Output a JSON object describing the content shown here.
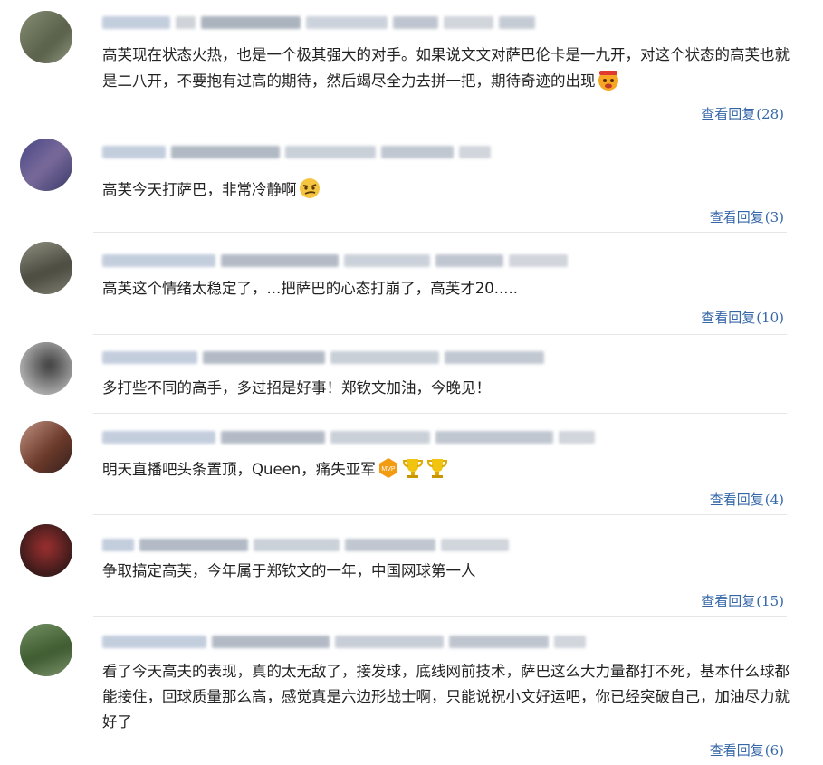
{
  "comments": [
    {
      "text": "高芙现在状态火热，也是一个极其强大的对手。如果说文文对萨巴伦卡是一九开，对这个状态的高芙也就是二八开，不要抱有过高的期待，然后竭尽全力去拼一把，期待奇迹的出现",
      "reply_label": "查看回复",
      "reply_count": "(28)",
      "emojis": [
        "angry-face-emoji"
      ],
      "avatar": "#6f7a5e"
    },
    {
      "text": "高芙今天打萨巴，非常冷静啊",
      "reply_label": "查看回复",
      "reply_count": "(3)",
      "emojis": [
        "smirk-face-emoji"
      ],
      "avatar": "#4a4f7a"
    },
    {
      "text": "高芙这个情绪太稳定了，...把萨巴的心态打崩了，高芙才20.....",
      "reply_label": "查看回复",
      "reply_count": "(10)",
      "emojis": [],
      "avatar": "#6a6a5a"
    },
    {
      "text": "多打些不同的高手，多过招是好事！郑钦文加油，今晚见！",
      "reply_label": "",
      "reply_count": "",
      "emojis": [],
      "avatar": "#8a8a8a"
    },
    {
      "text": "明天直播吧头条置顶，Queen，痛失亚军",
      "reply_label": "查看回复",
      "reply_count": "(4)",
      "emojis": [
        "mvp-badge-emoji",
        "trophy-emoji",
        "trophy-emoji"
      ],
      "avatar": "#6b4a3a"
    },
    {
      "text": "争取搞定高芙，今年属于郑钦文的一年，中国网球第一人",
      "reply_label": "查看回复",
      "reply_count": "(15)",
      "emojis": [],
      "avatar": "#5a2a2a"
    },
    {
      "text": "看了今天高夫的表现，真的太无敌了，接发球，底线网前技术，萨巴这么大力量都打不死，基本什么球都能接住，回球质量那么高，感觉真是六边形战士啊，只能说祝小文好运吧，你已经突破自己，加油尽力就好了",
      "reply_label": "查看回复",
      "reply_count": "(6)",
      "emojis": [],
      "avatar": "#5e7a4e"
    }
  ]
}
